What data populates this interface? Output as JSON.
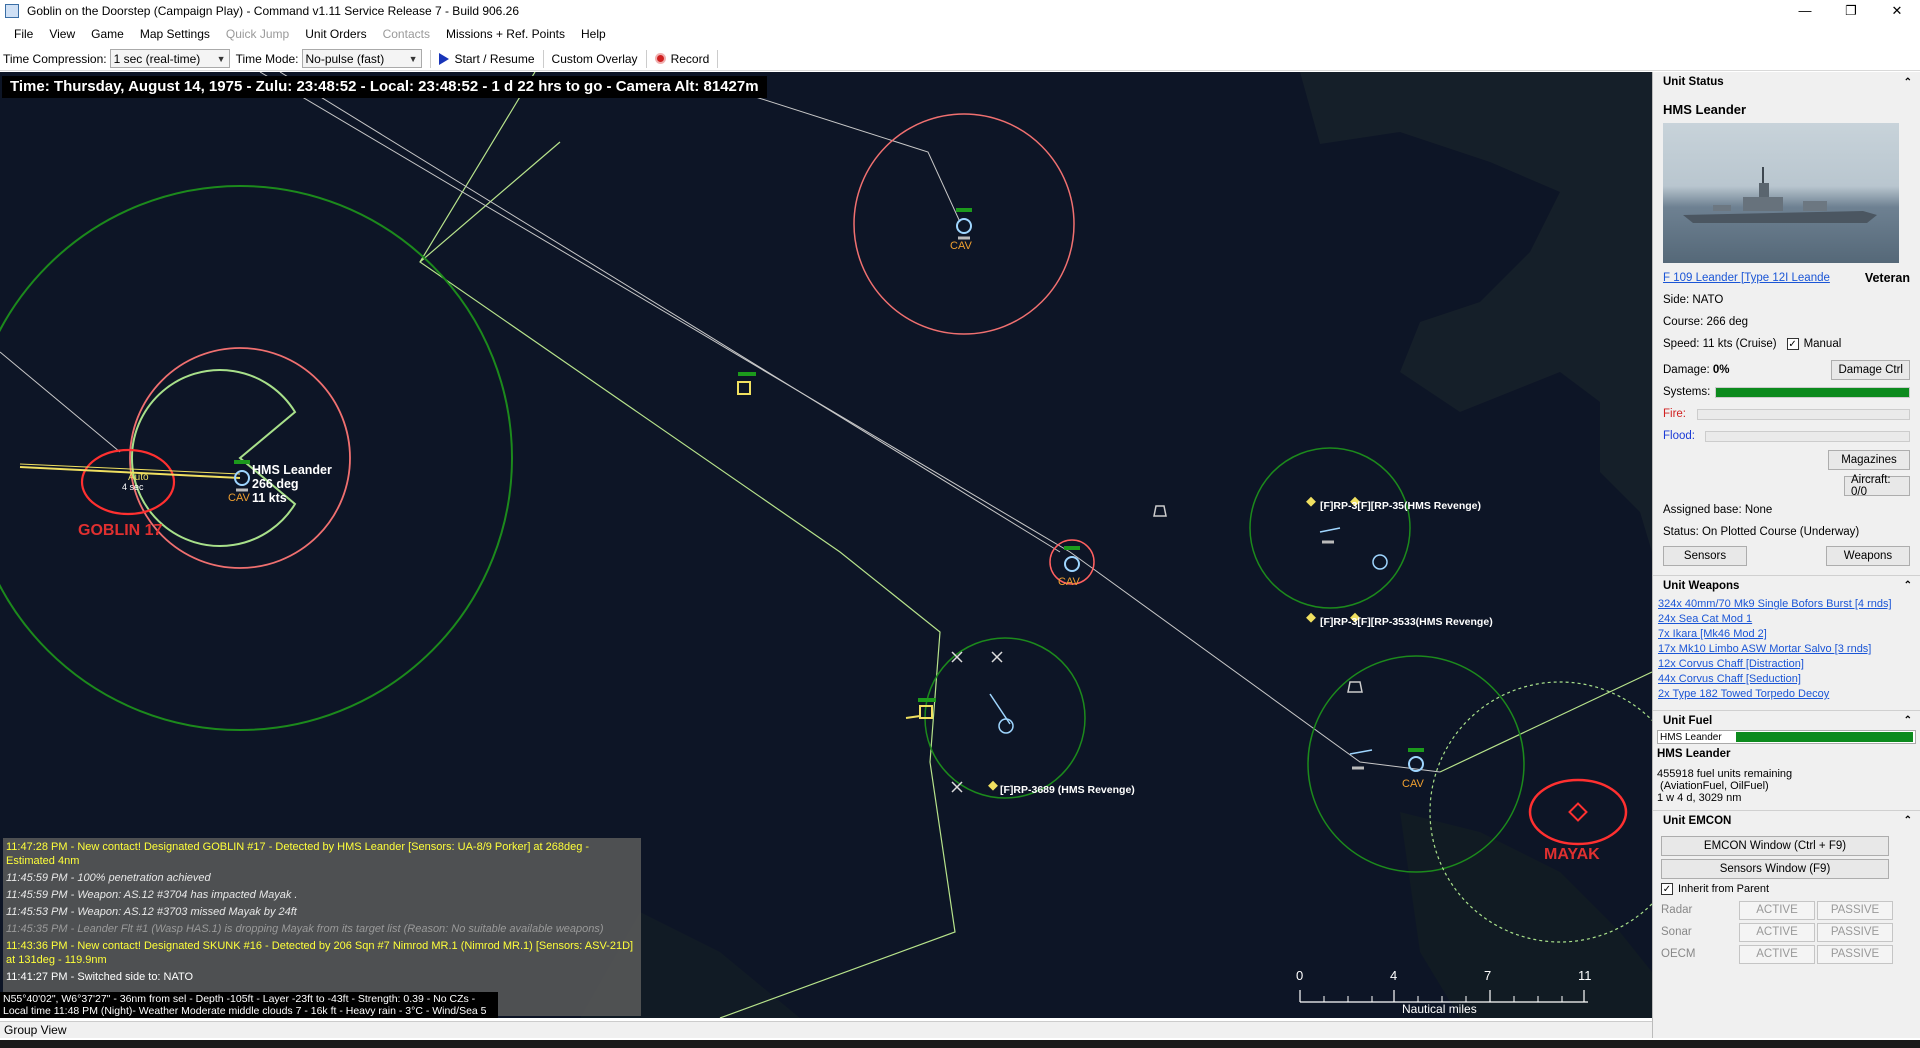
{
  "window": {
    "title": "Goblin on the Doorstep (Campaign Play) - Command v1.11 Service Release 7 - Build 906.26",
    "minimize": "—",
    "maximize": "❐",
    "close": "✕"
  },
  "menu": {
    "items": [
      {
        "label": "File",
        "disabled": false
      },
      {
        "label": "View",
        "disabled": false
      },
      {
        "label": "Game",
        "disabled": false
      },
      {
        "label": "Map Settings",
        "disabled": false
      },
      {
        "label": "Quick Jump",
        "disabled": true
      },
      {
        "label": "Unit Orders",
        "disabled": false
      },
      {
        "label": "Contacts",
        "disabled": true
      },
      {
        "label": "Missions + Ref. Points",
        "disabled": false
      },
      {
        "label": "Help",
        "disabled": false
      }
    ]
  },
  "toolbar": {
    "time_compression_label": "Time Compression:",
    "time_compression_value": "1 sec (real-time)",
    "time_mode_label": "Time Mode:",
    "time_mode_value": "No-pulse (fast)",
    "start_resume": "Start / Resume",
    "custom_overlay": "Custom Overlay",
    "record": "Record"
  },
  "map": {
    "time_header": "Time: Thursday, August 14, 1975 - Zulu: 23:48:52 - Local: 23:48:52 - 1 d 22 hrs to go -  Camera Alt: 81427m",
    "labels": {
      "goblin": "GOBLIN 17",
      "mayak": "MAYAK",
      "hms_name": "HMS Leander",
      "hms_course": "266 deg",
      "hms_speed": "11 kts",
      "cav": "CAV",
      "auto": "Auto",
      "sec": "4 sec",
      "rp_top": "[F]RP-3[F][RP-35(HMS Revenge)",
      "rp_mid": "[F]RP-3[F][RP-3533(HMS Revenge)",
      "rp_bottom": "[F]RP-3689 (HMS Revenge)"
    },
    "messages": [
      {
        "text": "11:47:28 PM - New contact! Designated GOBLIN #17 - Detected by HMS Leander  [Sensors: UA-8/9 Porker] at 268deg - Estimated 4nm",
        "style": "yellow"
      },
      {
        "text": "11:45:59 PM - 100% penetration achieved",
        "style": "italic"
      },
      {
        "text": "11:45:59 PM - Weapon: AS.12 #3704 has impacted Mayak .",
        "style": "italic"
      },
      {
        "text": "11:45:53 PM - Weapon: AS.12 #3703 missed Mayak  by 24ft",
        "style": "italic"
      },
      {
        "text": "11:45:35 PM - Leander Flt #1 (Wasp HAS.1) is dropping Mayak  from its target list (Reason: No suitable available weapons)",
        "style": "faded"
      },
      {
        "text": "11:43:36 PM - New contact! Designated SKUNK #16 - Detected by 206 Sqn #7 Nimrod MR.1 (Nimrod MR.1)  [Sensors: ASV-21D] at 131deg - 119.9nm",
        "style": "yellow"
      },
      {
        "text": "11:41:27 PM - Switched side to: NATO",
        "style": "normal"
      }
    ],
    "status_line_1": "N55°40'02\", W6°37'27\" - 36nm from sel - Depth -105ft - Layer -23ft to -43ft - Strength: 0.39 - No CZs -",
    "status_line_2": "Local time 11:48 PM (Night)- Weather Moderate middle clouds 7 - 16k ft - Heavy rain - 3°C - Wind/Sea 5",
    "scale": {
      "ticks": [
        "0",
        "4",
        "7",
        "11"
      ],
      "title": "Nautical miles"
    }
  },
  "group_view": "Group View",
  "unit_status": {
    "header": "Unit Status",
    "name": "HMS Leander",
    "class_link": "F 109 Leander [Type 12I Leande",
    "proficiency": "Veteran",
    "side": "Side: NATO",
    "course": "Course: 266 deg",
    "speed": "Speed: 11 kts (Cruise)",
    "manual": "Manual",
    "damage_label": "Damage:",
    "damage_value": "0%",
    "damage_ctrl": "Damage Ctrl",
    "systems_label": "Systems:",
    "systems_level": 1.0,
    "fire_label": "Fire:",
    "fire_level": 0,
    "flood_label": "Flood:",
    "flood_level": 0,
    "magazines": "Magazines",
    "aircraft": "Aircraft: 0/0",
    "assigned_base": "Assigned base: None",
    "status": "Status: On Plotted Course (Underway)",
    "sensors_btn": "Sensors",
    "weapons_btn": "Weapons",
    "colors": {
      "systems": "#0c8a1d",
      "fire": "#d02020",
      "flood": "#1a3ad6"
    }
  },
  "unit_weapons": {
    "header": "Unit Weapons",
    "items": [
      "324x 40mm/70 Mk9 Single Bofors Burst [4 rnds]",
      "24x Sea Cat Mod 1",
      "7x Ikara [Mk46 Mod 2]",
      "17x Mk10 Limbo ASW Mortar Salvo [3 rnds]",
      "12x Corvus Chaff [Distraction]",
      "44x Corvus Chaff [Seduction]",
      "2x Type 182 Towed Torpedo Decoy"
    ]
  },
  "unit_fuel": {
    "header": "Unit Fuel",
    "bar_label": "HMS Leander",
    "fuel_level": 1.0,
    "name": "HMS Leander",
    "remaining": "455918 fuel units remaining",
    "types": " (AviationFuel, OilFuel)",
    "endurance": "1 w 4 d, 3029 nm"
  },
  "unit_emcon": {
    "header": "Unit EMCON",
    "emcon_window": "EMCON Window (Ctrl + F9)",
    "sensors_window": "Sensors Window (F9)",
    "inherit": "Inherit from Parent",
    "rows": [
      {
        "label": "Radar",
        "active": "ACTIVE",
        "passive": "PASSIVE"
      },
      {
        "label": "Sonar",
        "active": "ACTIVE",
        "passive": "PASSIVE"
      },
      {
        "label": "OECM",
        "active": "ACTIVE",
        "passive": "PASSIVE"
      }
    ]
  }
}
